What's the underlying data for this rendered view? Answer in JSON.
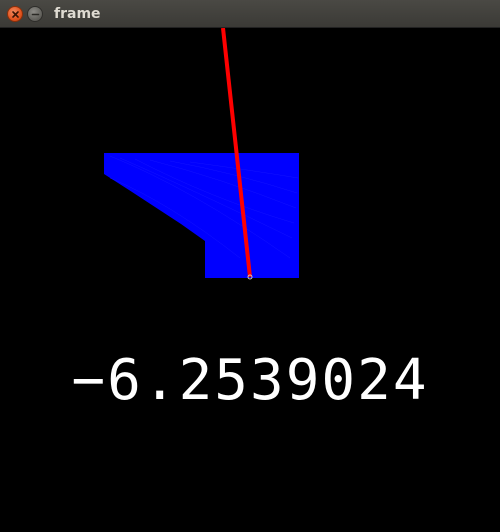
{
  "window": {
    "title": "frame"
  },
  "readout": {
    "value": "−6.2539024"
  },
  "colors": {
    "background": "#000000",
    "shape": "#0000ff",
    "pointer": "#ff0000",
    "text": "#ffffff"
  }
}
